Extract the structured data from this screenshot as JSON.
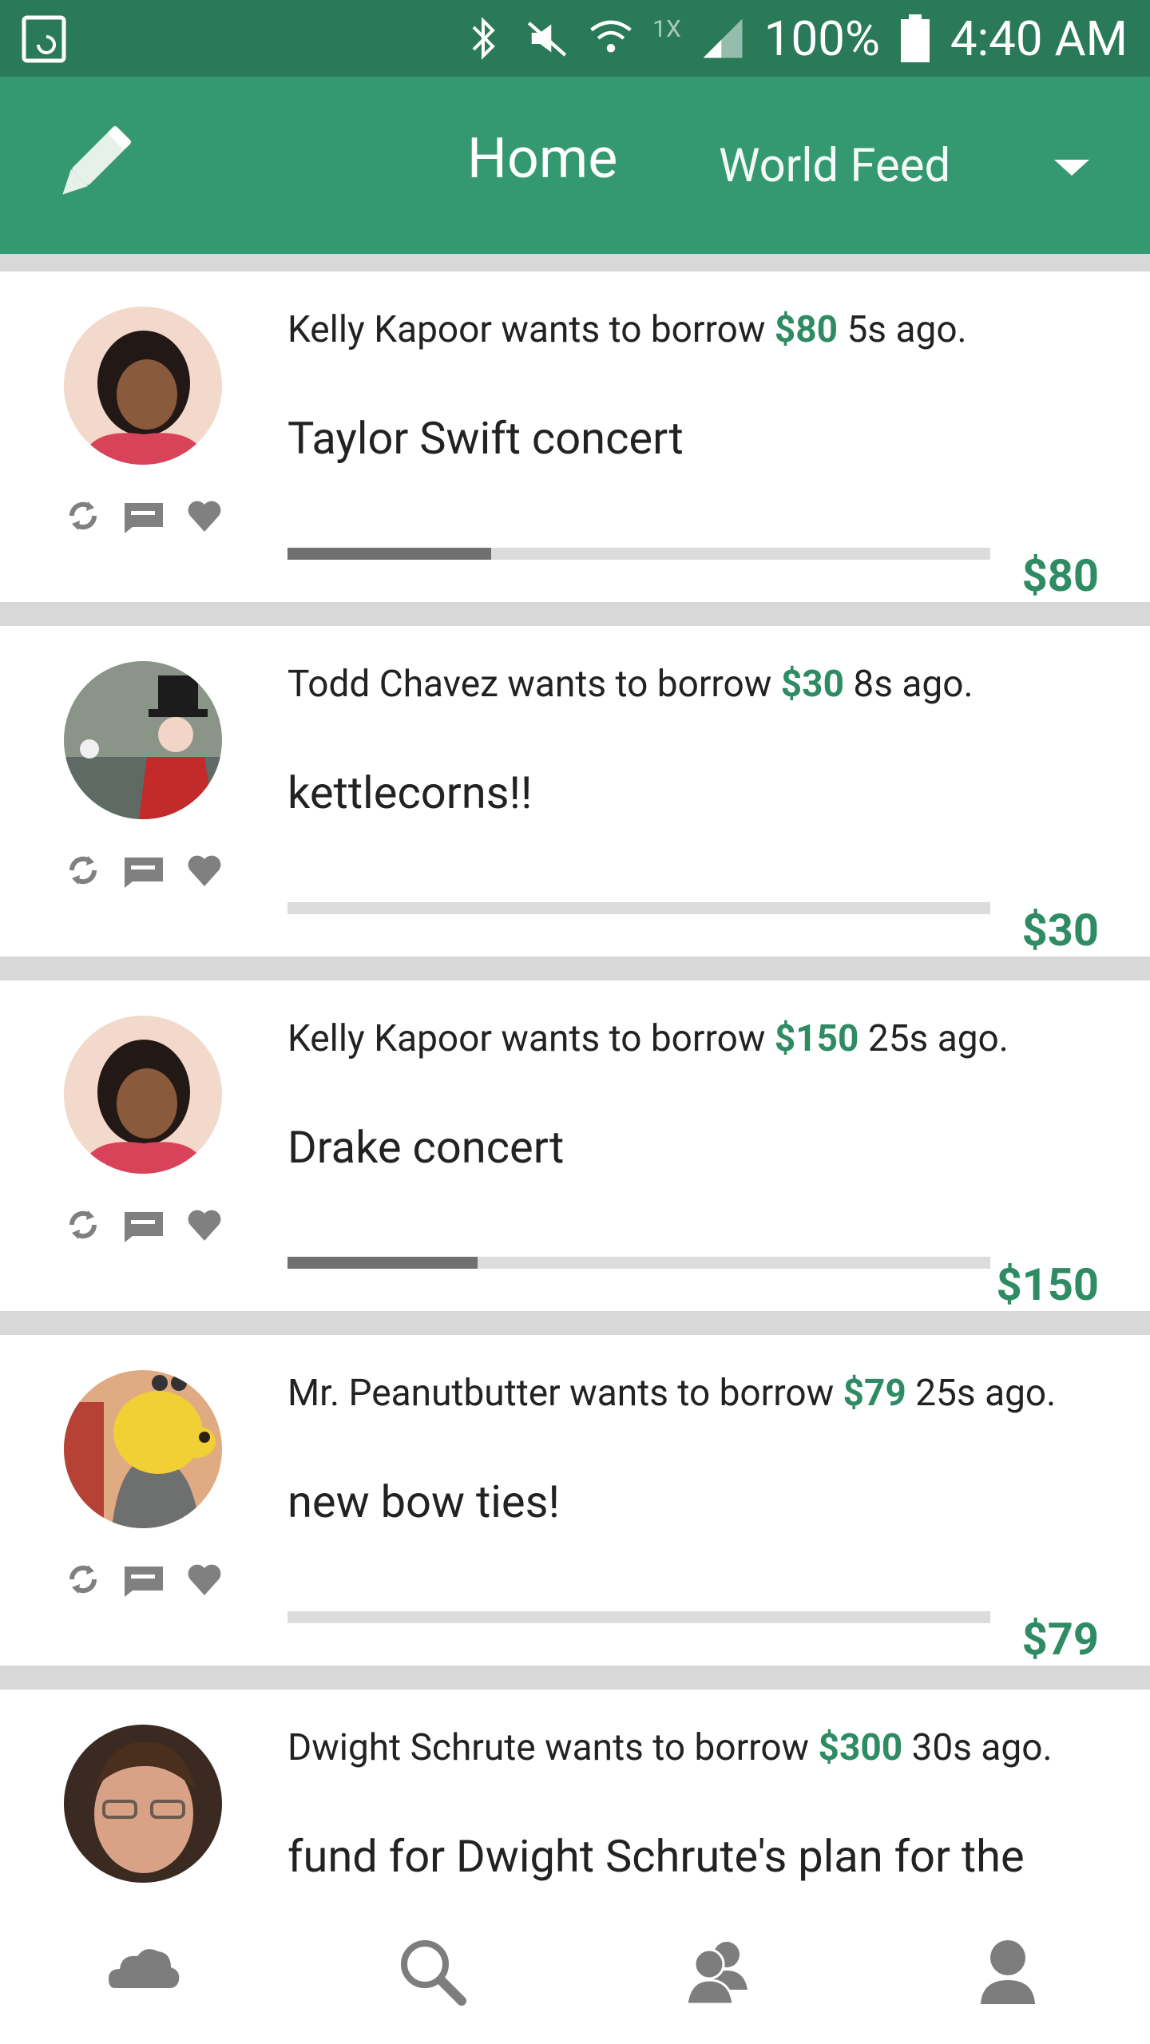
{
  "status": {
    "battery": "100%",
    "time": "4:40 AM",
    "speed": "1X"
  },
  "appbar": {
    "home_label": "Home",
    "world_label": "World Feed"
  },
  "feed": [
    {
      "name": "Kelly Kapoor",
      "middle": " wants to borrow ",
      "amount": "$80",
      "suffix": " 5s ago.",
      "title": "Taylor Swift concert",
      "goal": "$80",
      "progress": 0.29
    },
    {
      "name": "Todd Chavez",
      "middle": " wants to borrow ",
      "amount": "$30",
      "suffix": " 8s ago.",
      "title": "kettlecorns!!",
      "goal": "$30",
      "progress": 0
    },
    {
      "name": "Kelly Kapoor",
      "middle": " wants to borrow ",
      "amount": "$150",
      "suffix": " 25s ago.",
      "title": "Drake concert",
      "goal": "$150",
      "progress": 0.27
    },
    {
      "name": "Mr. Peanutbutter",
      "middle": " wants to borrow ",
      "amount": "$79",
      "suffix": " 25s ago.",
      "title": "new bow ties!",
      "goal": "$79",
      "progress": 0
    },
    {
      "name": "Dwight Schrute",
      "middle": " wants to borrow ",
      "amount": "$300",
      "suffix": " 30s ago.",
      "title": "fund for Dwight Schrute's plan for the",
      "goal": "",
      "progress": 0
    }
  ]
}
